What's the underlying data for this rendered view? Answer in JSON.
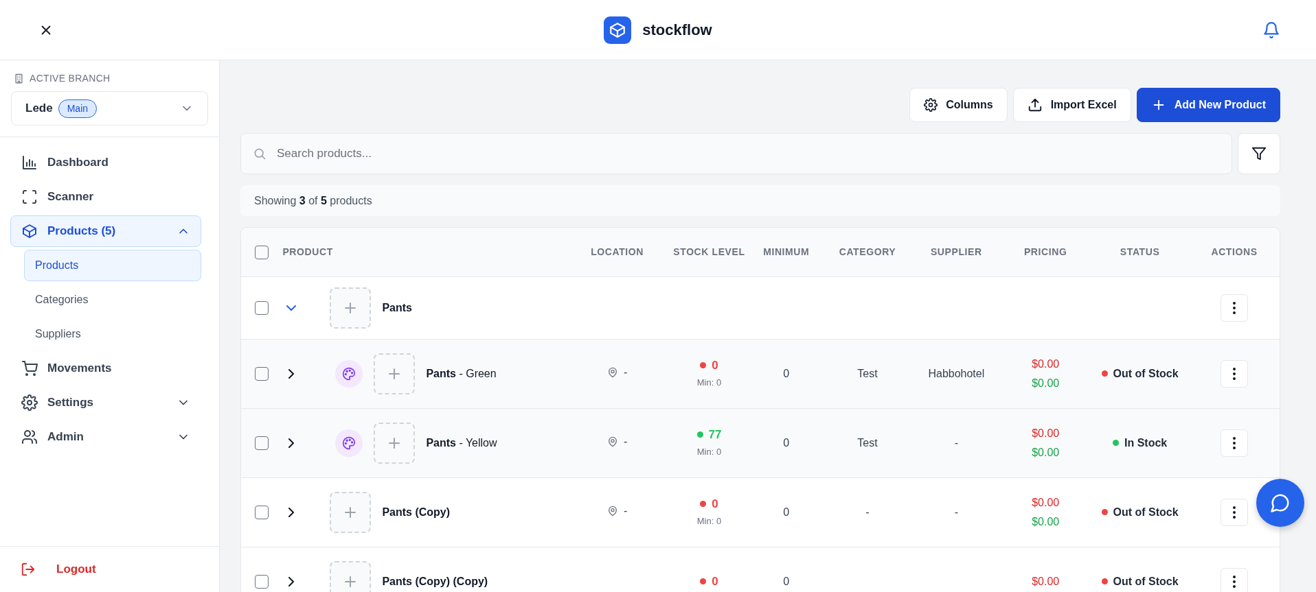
{
  "header": {
    "title": "stockflow"
  },
  "branch": {
    "heading": "ACTIVE BRANCH",
    "name": "Lede",
    "badge": "Main"
  },
  "sidebar": {
    "items": [
      {
        "label": "Dashboard",
        "selected": false
      },
      {
        "label": "Scanner",
        "selected": false
      },
      {
        "label": "Products (5)",
        "selected": true,
        "expanded": true,
        "children": [
          {
            "label": "Products",
            "selected": true
          },
          {
            "label": "Categories",
            "selected": false
          },
          {
            "label": "Suppliers",
            "selected": false
          }
        ]
      },
      {
        "label": "Movements",
        "selected": false
      },
      {
        "label": "Settings",
        "selected": false,
        "expanded": false
      },
      {
        "label": "Admin",
        "selected": false,
        "expanded": false
      }
    ],
    "logout": "Logout"
  },
  "toolbar": {
    "buttons": [
      "Columns",
      "Import Excel",
      "Add New Product"
    ]
  },
  "search": {
    "placeholder": "Search products..."
  },
  "summary": "Showing **3** of **5** products",
  "table": {
    "columns": [
      "PRODUCT",
      "LOCATION",
      "STOCK LEVEL",
      "MINIMUM",
      "CATEGORY",
      "SUPPLIER",
      "PRICING",
      "STATUS",
      "ACTIONS"
    ],
    "header_checked": false,
    "rows": [
      {
        "kind": "group",
        "checked": false,
        "expanded": true,
        "name": "Pants"
      },
      {
        "kind": "variant",
        "checked": false,
        "expanded": false,
        "name": "**Pants** - Green",
        "location": "-",
        "stock": "0",
        "min": "Min: 0",
        "minimum": "0",
        "category": "Test",
        "supplier": "Habbohotel",
        "price": "$0.00",
        "cost": "$0.00",
        "status": "Out of Stock",
        "color": "#ef4444"
      },
      {
        "kind": "variant",
        "checked": false,
        "expanded": false,
        "name": "**Pants** - Yellow",
        "location": "-",
        "stock": "77",
        "min": "Min: 0",
        "minimum": "0",
        "category": "Test",
        "supplier": "-",
        "price": "$0.00",
        "cost": "$0.00",
        "status": "In Stock",
        "color": "#22c55e"
      },
      {
        "kind": "product",
        "checked": false,
        "expanded": false,
        "name": "Pants (Copy)",
        "location": "-",
        "stock": "0",
        "min": "Min: 0",
        "minimum": "0",
        "category": "-",
        "supplier": "-",
        "price": "$0.00",
        "cost": "$0.00",
        "status": "Out of Stock",
        "color": "#ef4444"
      },
      {
        "kind": "product",
        "checked": false,
        "expanded": false,
        "name": "Pants (Copy) (Copy)",
        "stock": "0",
        "minimum": "0",
        "price": "$0.00",
        "status": "Out of Stock",
        "color": "#ef4444"
      }
    ]
  }
}
